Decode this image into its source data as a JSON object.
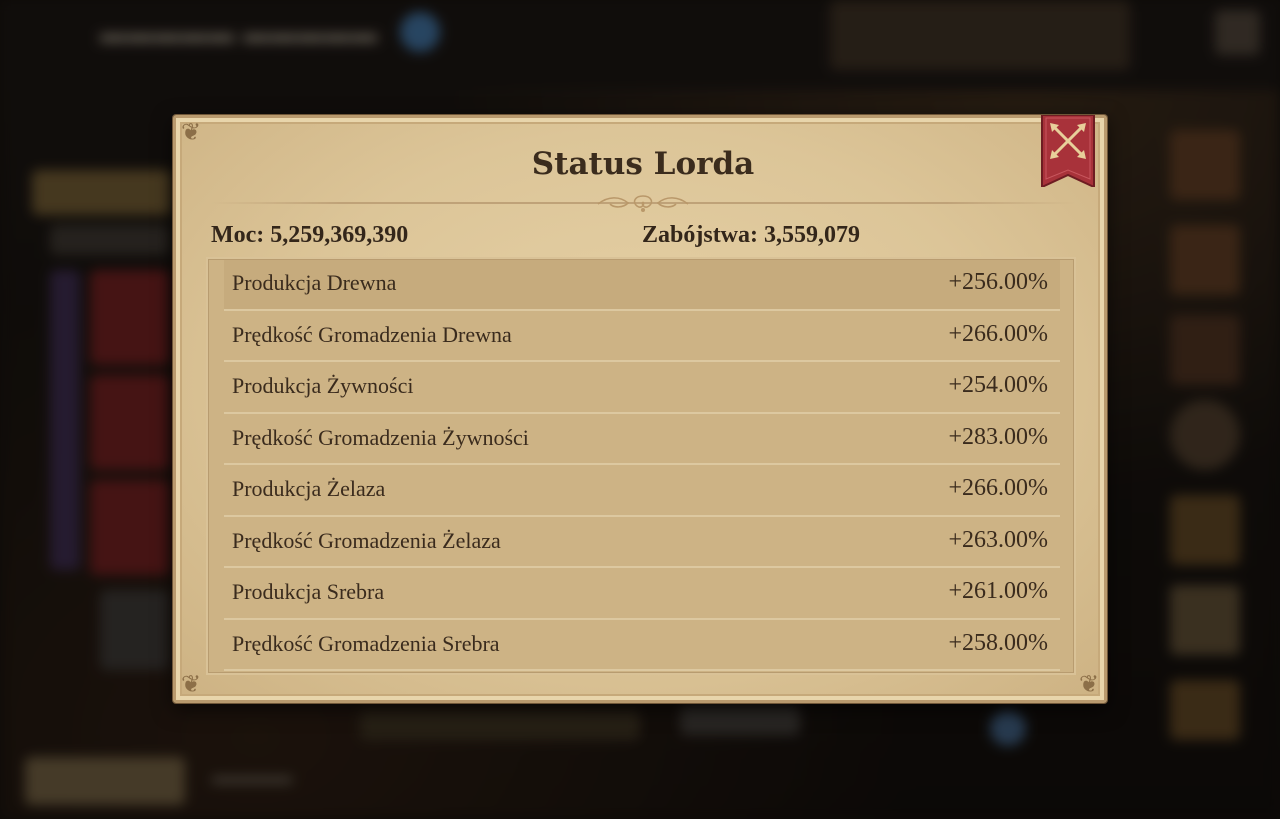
{
  "dialog": {
    "title": "Status Lorda",
    "power_label": "Moc: 5,259,369,390",
    "kills_label": "Zabójstwa: 3,559,079",
    "close_icon": "close-crossed-arrows-icon",
    "stats": [
      {
        "name": "Produkcja Drewna",
        "value": "+256.00%"
      },
      {
        "name": "Prędkość Gromadzenia Drewna",
        "value": "+266.00%"
      },
      {
        "name": "Produkcja Żywności",
        "value": "+254.00%"
      },
      {
        "name": "Prędkość Gromadzenia Żywności",
        "value": "+283.00%"
      },
      {
        "name": "Produkcja Żelaza",
        "value": "+266.00%"
      },
      {
        "name": "Prędkość Gromadzenia Żelaza",
        "value": "+263.00%"
      },
      {
        "name": "Produkcja Srebra",
        "value": "+261.00%"
      },
      {
        "name": "Prędkość Gromadzenia Srebra",
        "value": "+258.00%"
      }
    ]
  },
  "colors": {
    "parchment": "#dcc598",
    "text": "#3a2b1d",
    "close_banner": "#a8323a",
    "close_icon": "#e8cf9a"
  }
}
